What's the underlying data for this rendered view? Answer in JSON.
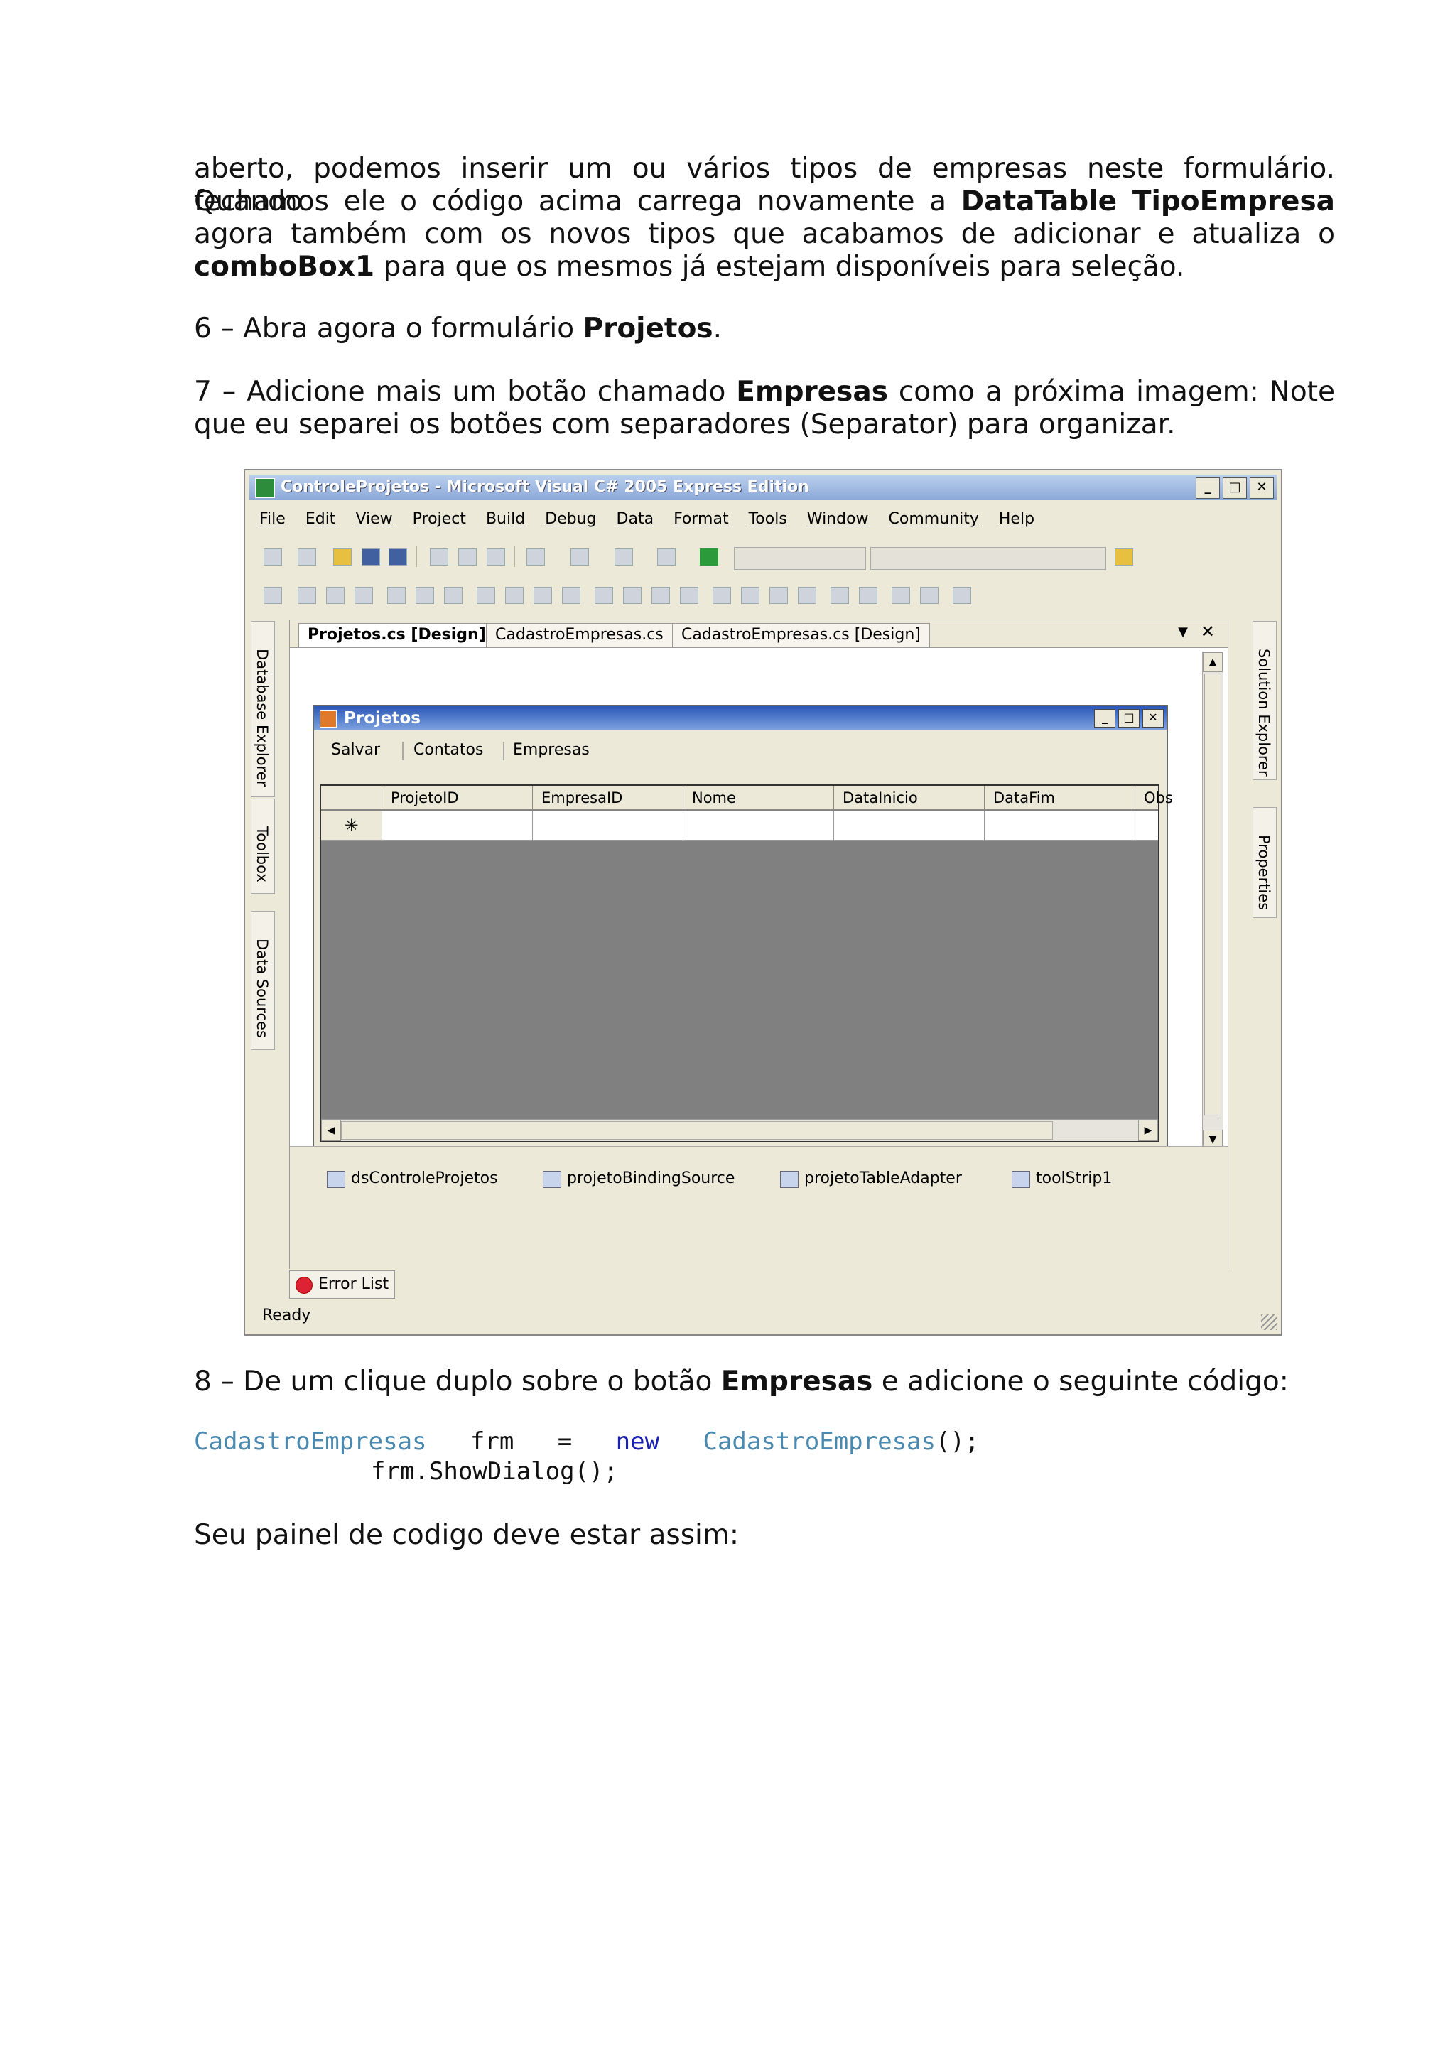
{
  "paragraphs": {
    "p1_line1": "aberto, podemos inserir um ou vários tipos de empresas neste formulário. Quando",
    "p1_line2_a": "fechamos ele o código acima carrega novamente a ",
    "p1_line2_b": "DataTable TipoEmpresa",
    "p1_line3": "agora também com os novos tipos que acabamos de adicionar e atualiza o",
    "p1_line4_a": "comboBox1",
    "p1_line4_b": " para que os mesmos já estejam disponíveis para seleção.",
    "step6_a": "6 – Abra agora o formulário ",
    "step6_b": "Projetos",
    "step6_c": ".",
    "step7_line1_a": "7 – Adicione mais um botão chamado ",
    "step7_line1_b": "Empresas",
    "step7_line1_c": " como a próxima imagem: Note",
    "step7_line2": "que eu separei os botões com separadores (Separator) para organizar.",
    "step8_a": "8 – De um clique duplo sobre o botão ",
    "step8_b": "Empresas",
    "step8_c": " e adicione o seguinte código:",
    "closing": "Seu painel de codigo deve estar assim:"
  },
  "code": {
    "line1_type": "CadastroEmpresas",
    "line1_var": "   frm   =   ",
    "line1_new": "new",
    "line1_sp": "   ",
    "line1_type2": "CadastroEmpresas",
    "line1_end": "();",
    "line2": "frm.ShowDialog();"
  },
  "screenshot": {
    "window_title": "ControleProjetos - Microsoft Visual C# 2005 Express Edition",
    "menu": [
      "File",
      "Edit",
      "View",
      "Project",
      "Build",
      "Debug",
      "Data",
      "Format",
      "Tools",
      "Window",
      "Community",
      "Help"
    ],
    "side_left": [
      "Database Explorer",
      "Toolbox",
      "Data Sources"
    ],
    "side_right": [
      "Solution Explorer",
      "Properties"
    ],
    "tabs": [
      "Projetos.cs [Design]",
      "CadastroEmpresas.cs",
      "CadastroEmpresas.cs [Design]"
    ],
    "form_title": "Projetos",
    "toolstrip": [
      "Salvar",
      "Contatos",
      "Empresas"
    ],
    "grid_columns": [
      "ProjetoID",
      "EmpresaID",
      "Nome",
      "DataInicio",
      "DataFim",
      "Obs"
    ],
    "new_row_marker": "✳",
    "components": [
      "dsControleProjetos",
      "projetoBindingSource",
      "projetoTableAdapter",
      "toolStrip1"
    ],
    "error_tab": "Error List",
    "status": "Ready"
  }
}
